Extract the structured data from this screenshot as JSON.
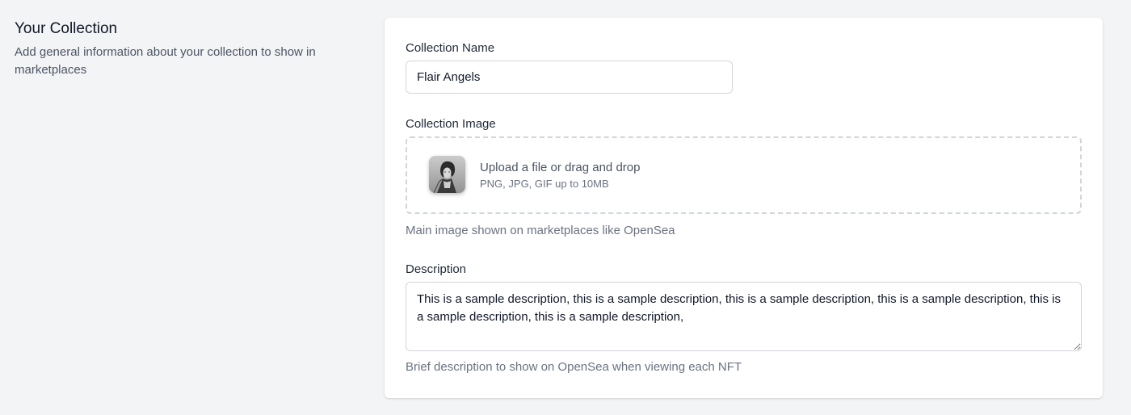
{
  "intro": {
    "title": "Your Collection",
    "description": "Add general information about your collection to show in marketplaces"
  },
  "form": {
    "name": {
      "label": "Collection Name",
      "value": "Flair Angels"
    },
    "image": {
      "label": "Collection Image",
      "upload_link": "Upload a file",
      "upload_rest": " or drag and drop",
      "formats": "PNG, JPG, GIF up to 10MB",
      "help": "Main image shown on marketplaces like OpenSea"
    },
    "description": {
      "label": "Description",
      "value": "This is a sample description, this is a sample description, this is a sample description, this is a sample description, this is a sample description, this is a sample description,",
      "help": "Brief description to show on OpenSea when viewing each NFT"
    }
  },
  "colors": {
    "background": "#f3f4f6",
    "card": "#ffffff",
    "border": "#d1d5db",
    "muted_text": "#6b7280"
  }
}
